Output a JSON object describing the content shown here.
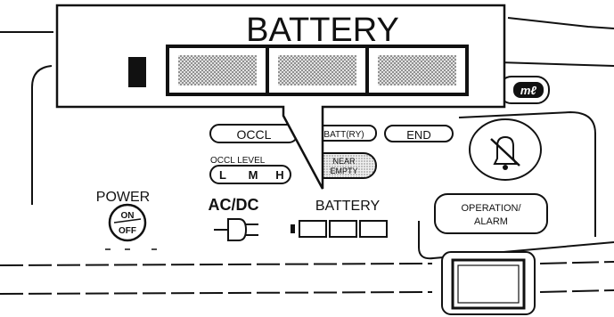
{
  "callout": {
    "title": "BATTERY",
    "segments": 3
  },
  "panel": {
    "top_button_partial": "mℓ",
    "indicators": {
      "occl": "OCCL",
      "battery": "BATT(RY)",
      "end": "END",
      "near_empty_line1": "NEAR",
      "near_empty_line2": "EMPTY"
    },
    "occl_level": {
      "label": "OCCL LEVEL",
      "levels": [
        "L",
        "M",
        "H"
      ]
    },
    "power": {
      "label": "POWER",
      "on": "ON",
      "off": "OFF"
    },
    "acdc": {
      "label": "AC/DC"
    },
    "battery": {
      "label": "BATTERY",
      "segments": 3
    },
    "operation_alarm": {
      "line1": "OPERATION/",
      "line2": "ALARM"
    }
  },
  "icons": {
    "alarm_silence": "bell-crossed-icon",
    "plug": "plug-icon",
    "battery_small": "battery-gauge-icon",
    "battery_large": "battery-gauge-large-icon"
  },
  "colors": {
    "ink": "#111111",
    "paper": "#ffffff",
    "stipple": "#bdbdbd"
  }
}
